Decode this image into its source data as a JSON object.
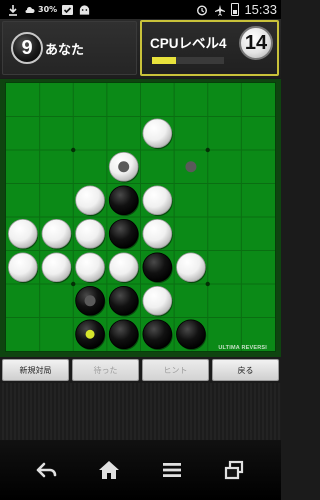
{
  "status_bar": {
    "battery_text": "30%",
    "time": "15:33",
    "icons": [
      "download-icon",
      "cloud-icon",
      "task-check-icon",
      "android-icon",
      "alarm-icon",
      "airplane-mode-icon",
      "battery-charging-icon"
    ]
  },
  "score": {
    "player": {
      "label": "あなた",
      "disc_count": "9",
      "disc_color": "black"
    },
    "cpu": {
      "label": "CPUレベル4",
      "disc_count": "14",
      "disc_color": "white",
      "thinking_progress": 0.33
    },
    "active_turn": "cpu"
  },
  "board": {
    "size": 8,
    "rows": [
      "........",
      "....W...",
      "...W....",
      "..WBW...",
      "WWWBW...",
      "WWWWBW..",
      "..BBW...",
      "..BBBB.."
    ],
    "move_hints": [
      {
        "row": 2,
        "col": 3
      },
      {
        "row": 2,
        "col": 5
      },
      {
        "row": 6,
        "col": 2
      }
    ],
    "last_move": {
      "row": 7,
      "col": 2
    },
    "star_points": [
      {
        "row": 2,
        "col": 2
      },
      {
        "row": 2,
        "col": 6
      },
      {
        "row": 6,
        "col": 2
      },
      {
        "row": 6,
        "col": 6
      }
    ],
    "colors": {
      "felt": "#0b8a17",
      "line": "#0a6e12",
      "white_disc": "#f0f0f0",
      "black_disc": "#111111",
      "hint": "#5a5a5a",
      "last_move_marker": "#d7e62c"
    },
    "brand": "ULTIMA REVERSI"
  },
  "actions": {
    "new_game": "新規対局",
    "undo": "待った",
    "hint": "ヒント",
    "back": "戻る"
  },
  "nav": {
    "back": "back-icon",
    "home": "home-icon",
    "menu": "menu-icon",
    "recents": "recents-icon"
  }
}
